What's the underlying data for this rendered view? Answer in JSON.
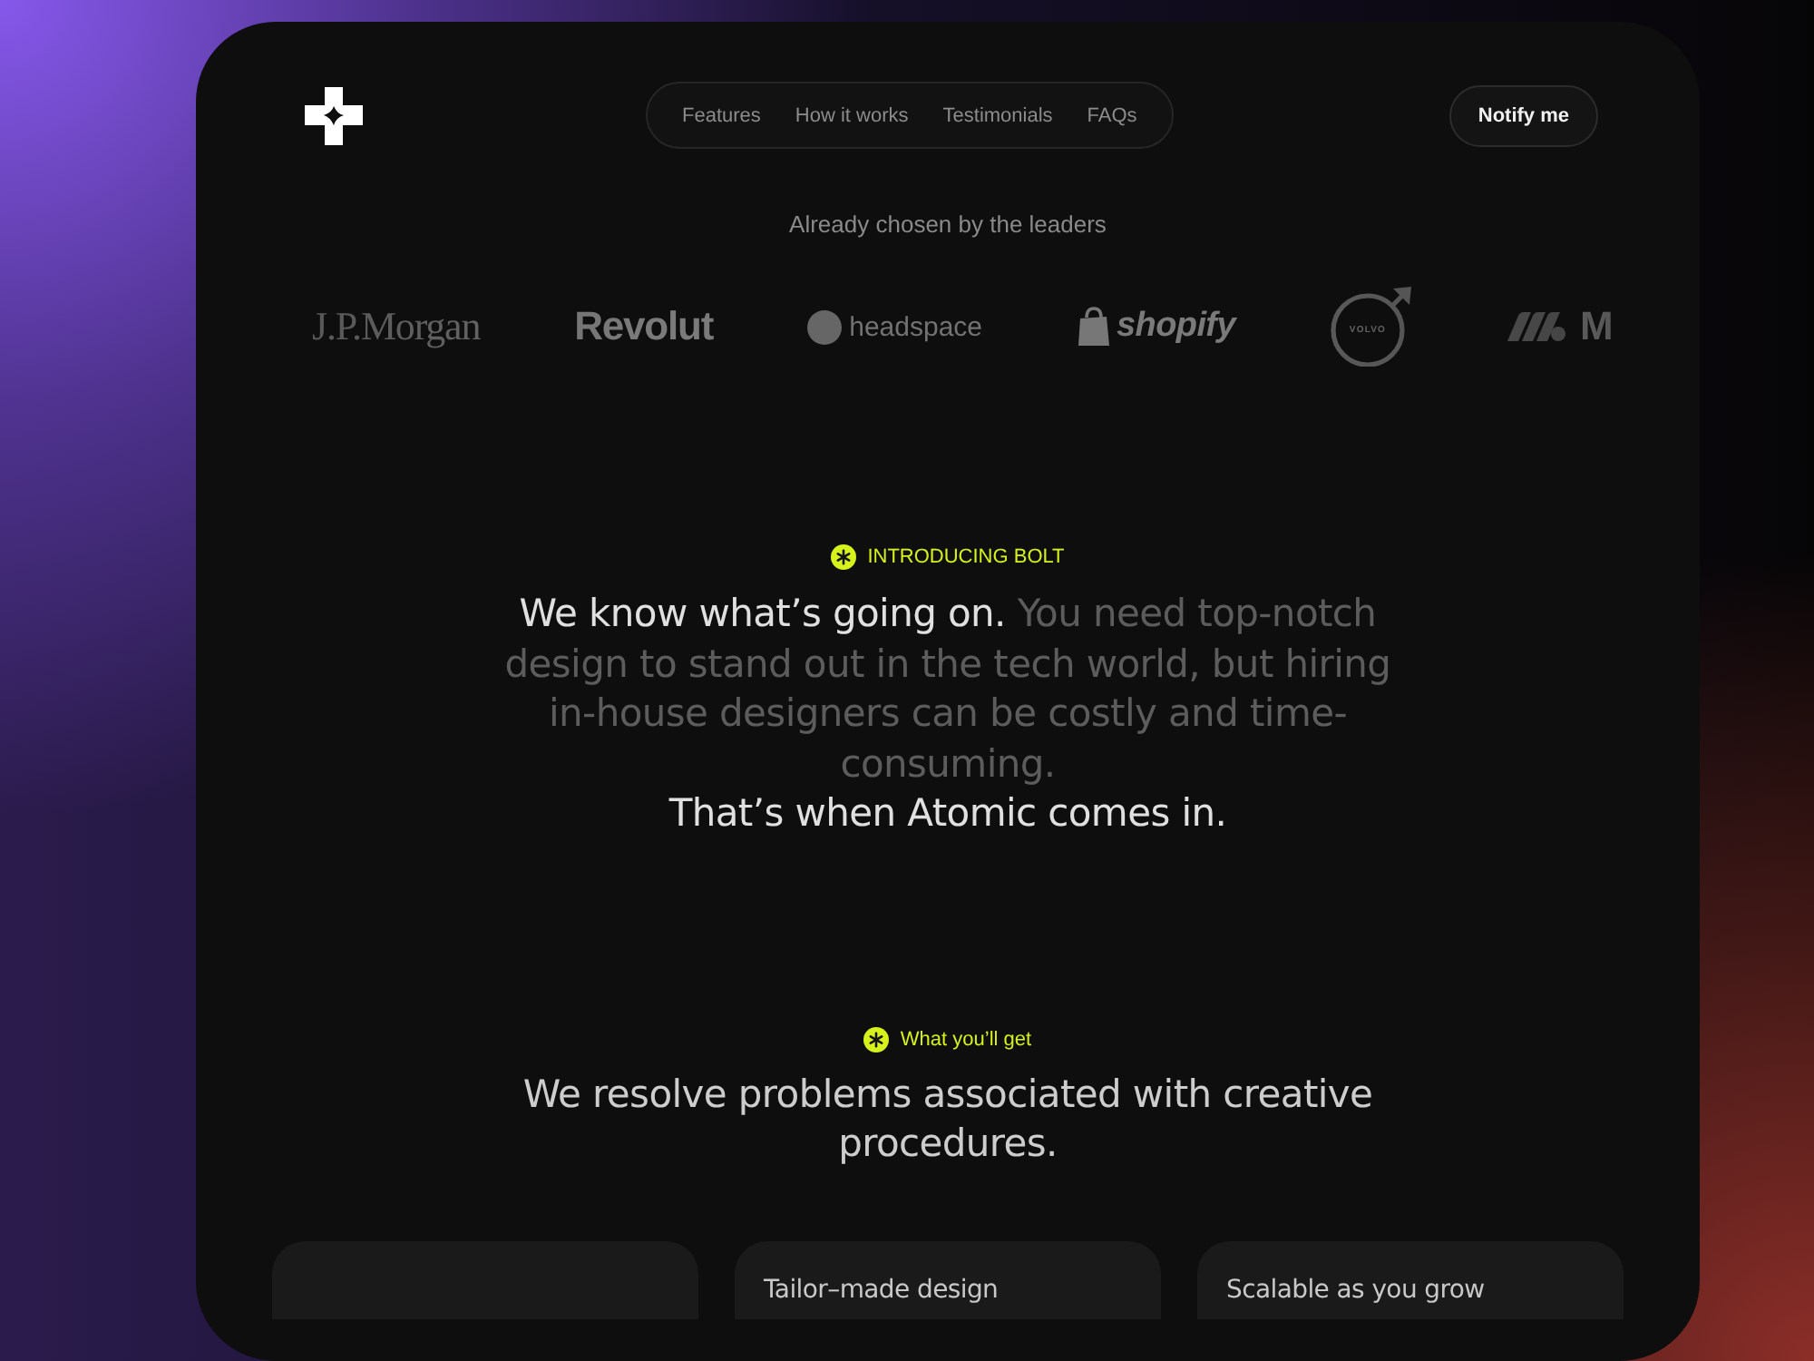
{
  "header": {
    "nav": [
      "Features",
      "How it works",
      "Testimonials",
      "FAQs"
    ],
    "button": "Notify me"
  },
  "clients": {
    "caption": "Already chosen by the leaders",
    "logos": [
      {
        "kind": "serif",
        "name": "J.P.Morgan"
      },
      {
        "kind": "bold",
        "name": "Revolut"
      },
      {
        "kind": "dot",
        "name": "headspace"
      },
      {
        "kind": "bag",
        "name": "shopify"
      },
      {
        "kind": "ring",
        "name": "VOLVO"
      },
      {
        "kind": "wave",
        "name": "M"
      }
    ]
  },
  "intro": {
    "badge": "INTRODUCING BOLT",
    "statement": {
      "highlight": "We know what’s going on.",
      "text": "You need top-notch design to stand out in the tech world, but hiring in-house designers can be costly and time-consuming."
    },
    "closing": "That’s when Atomic comes in."
  },
  "benefits": {
    "badge": "What you’ll get",
    "heading": "We resolve problems associated with creative procedures.",
    "cards": [
      {
        "kind": "blank"
      },
      {
        "kind": "titled",
        "title": "Tailor–made design"
      },
      {
        "kind": "titled",
        "title": "Scalable as you grow"
      }
    ]
  }
}
